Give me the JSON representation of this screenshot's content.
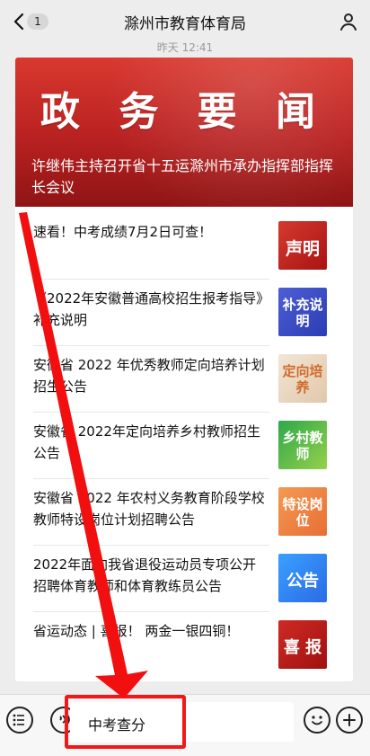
{
  "header": {
    "back_badge": "1",
    "title": "滁州市教育体育局",
    "time": "昨天 12:41"
  },
  "banner": {
    "headline": "政 务 要 闻",
    "title": "许继伟主持召开省十五运滁州市承办指挥部指挥长会议"
  },
  "items": [
    {
      "text": "速看！中考成绩7月2日可查！",
      "thumb": "声明"
    },
    {
      "text": "《2022年安徽普通高校招生报考指导》补充说明",
      "thumb": "补充说明"
    },
    {
      "text": "安徽省 2022 年优秀教师定向培养计划招生公告",
      "thumb": "定向培养"
    },
    {
      "text": "安徽省 2022年定向培养乡村教师招生公告",
      "thumb": "乡村教师"
    },
    {
      "text": "安徽省 2022 年农村义务教育阶段学校教师特设岗位计划招聘公告",
      "thumb": "特设岗位"
    },
    {
      "text": "2022年面向我省退役运动员专项公开招聘体育教师和体育教练员公告",
      "thumb": "公告"
    },
    {
      "text": "省运动态 | 喜报！ 两金一银四铜！",
      "thumb": "喜 报"
    }
  ],
  "input": {
    "value": "中考查分"
  },
  "icons": {
    "back": "back-icon",
    "person": "person-icon",
    "menu": "menu-icon",
    "voice": "voice-icon",
    "emoji": "emoji-icon",
    "plus": "plus-icon"
  }
}
